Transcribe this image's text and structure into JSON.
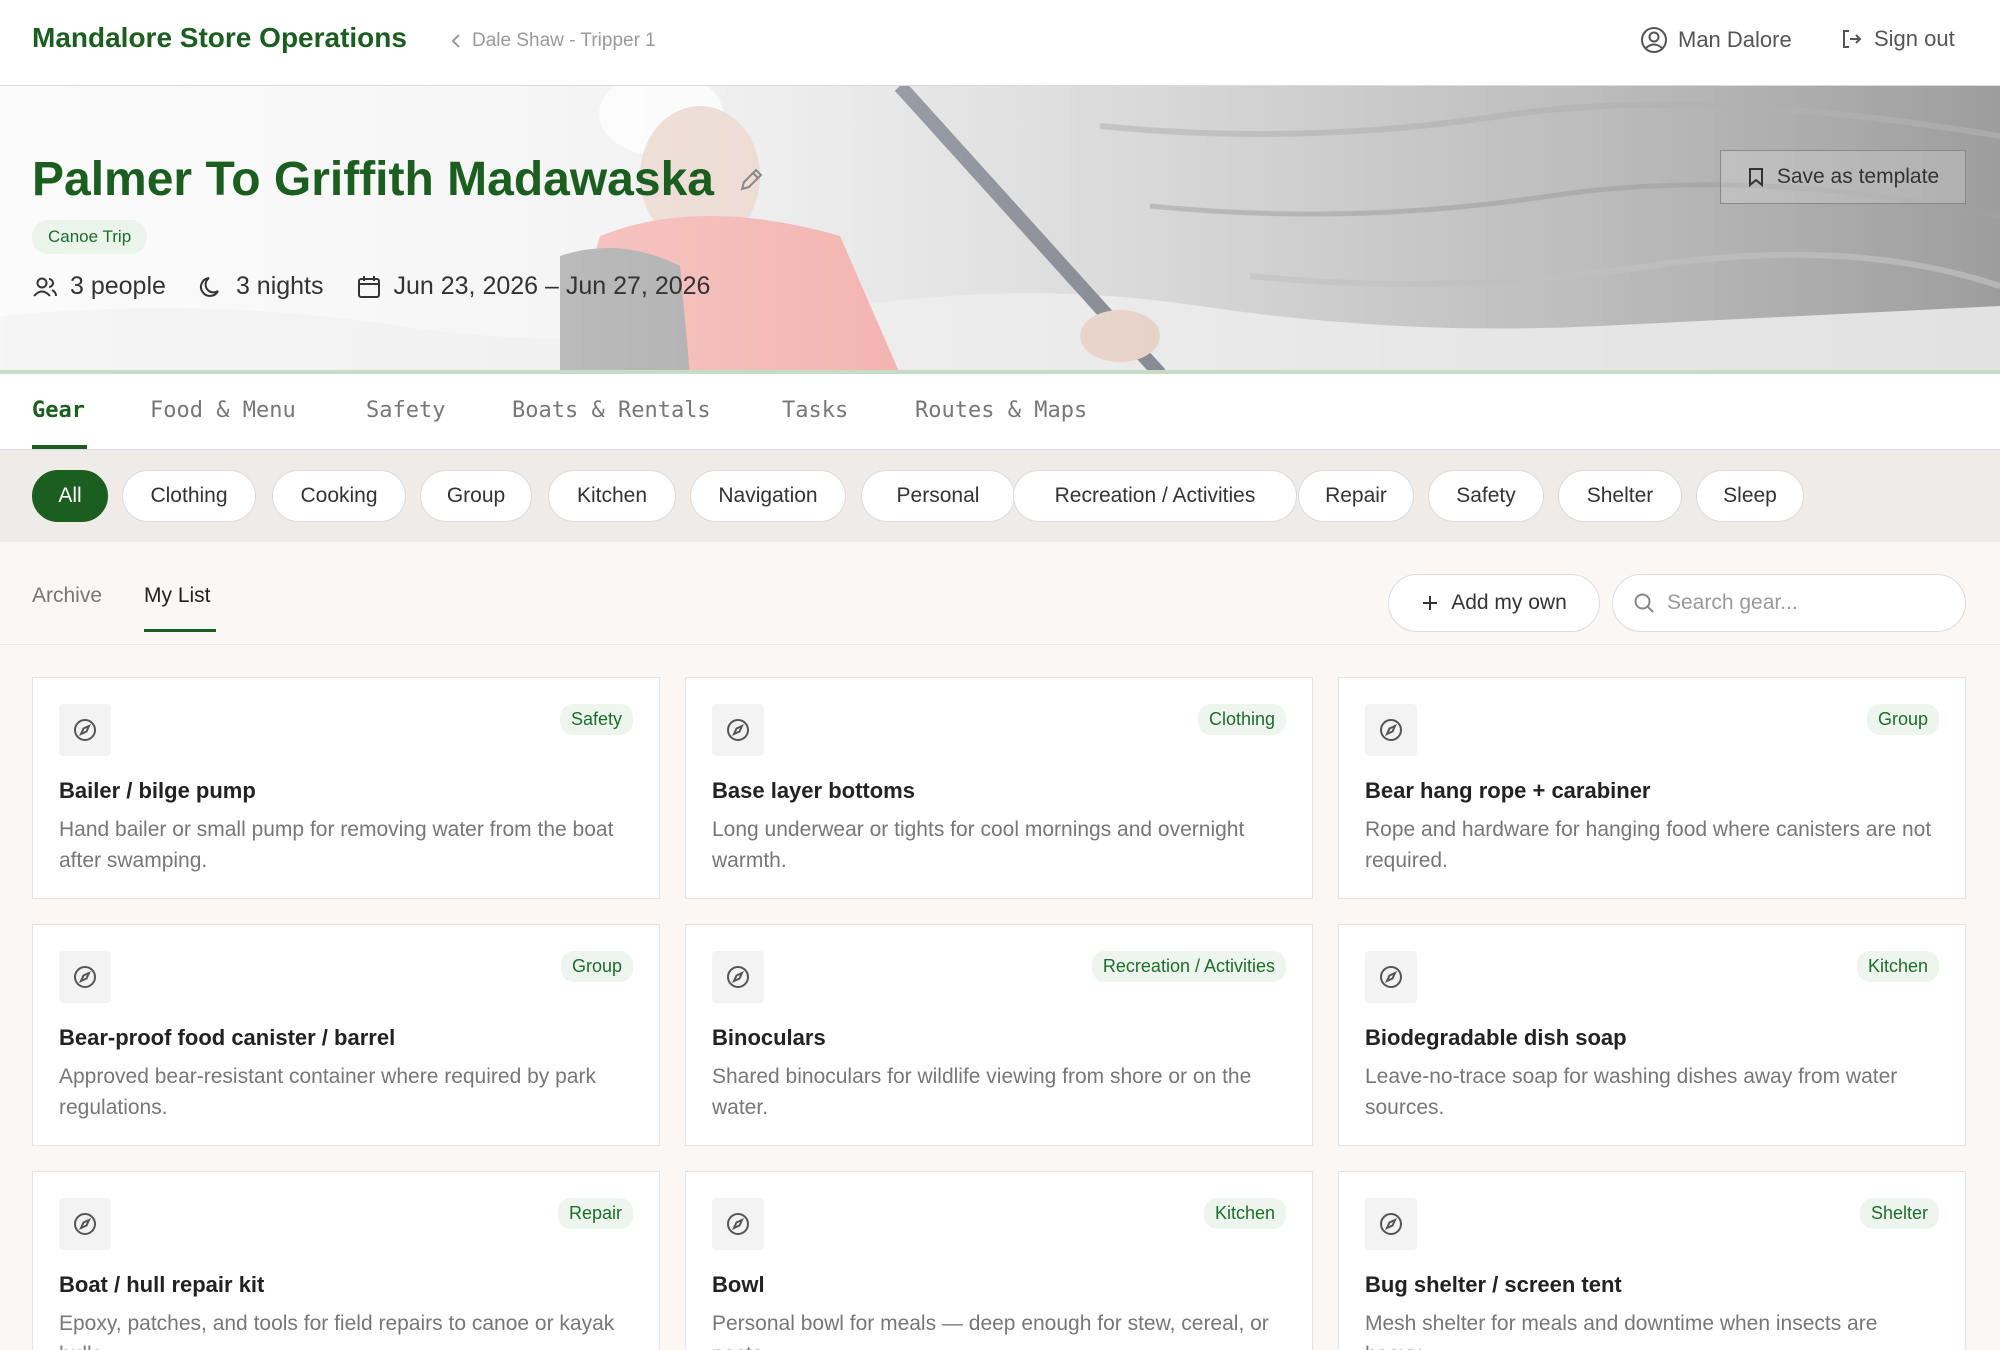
{
  "app": {
    "title": "Mandalore Store Operations"
  },
  "breadcrumb": {
    "label": "Dale Shaw - Tripper 1"
  },
  "user": {
    "name": "Man Dalore",
    "signout_label": "Sign out"
  },
  "trip": {
    "title": "Palmer To Griffith Madawaska",
    "type_badge": "Canoe Trip",
    "people": "3 people",
    "nights": "3 nights",
    "dates": "Jun 23, 2026 – Jun 27, 2026",
    "save_template_label": "Save as template"
  },
  "tabs": [
    {
      "label": "Gear",
      "active": true
    },
    {
      "label": "Food & Menu"
    },
    {
      "label": "Safety"
    },
    {
      "label": "Boats & Rentals"
    },
    {
      "label": "Tasks"
    },
    {
      "label": "Routes & Maps"
    }
  ],
  "categories": [
    {
      "label": "All",
      "active": true
    },
    {
      "label": "Clothing"
    },
    {
      "label": "Cooking"
    },
    {
      "label": "Group"
    },
    {
      "label": "Kitchen"
    },
    {
      "label": "Navigation"
    },
    {
      "label": "Personal"
    },
    {
      "label": "Recreation / Activities"
    },
    {
      "label": "Repair"
    },
    {
      "label": "Safety"
    },
    {
      "label": "Shelter"
    },
    {
      "label": "Sleep"
    }
  ],
  "list_tabs": [
    {
      "label": "Archive"
    },
    {
      "label": "My List",
      "active": true
    }
  ],
  "actions": {
    "add_own_label": "Add my own",
    "search_placeholder": "Search gear..."
  },
  "items": [
    {
      "title": "Bailer / bilge pump",
      "tag": "Safety",
      "description": "Hand bailer or small pump for removing water from the boat after swamping."
    },
    {
      "title": "Base layer bottoms",
      "tag": "Clothing",
      "description": "Long underwear or tights for cool mornings and overnight warmth."
    },
    {
      "title": "Bear hang rope + carabiner",
      "tag": "Group",
      "description": "Rope and hardware for hanging food where canisters are not required."
    },
    {
      "title": "Bear-proof food canister / barrel",
      "tag": "Group",
      "description": "Approved bear-resistant container where required by park regulations."
    },
    {
      "title": "Binoculars",
      "tag": "Recreation / Activities",
      "description": "Shared binoculars for wildlife viewing from shore or on the water."
    },
    {
      "title": "Biodegradable dish soap",
      "tag": "Kitchen",
      "description": "Leave-no-trace soap for washing dishes away from water sources."
    },
    {
      "title": "Boat / hull repair kit",
      "tag": "Repair",
      "description": "Epoxy, patches, and tools for field repairs to canoe or kayak hulls."
    },
    {
      "title": "Bowl",
      "tag": "Kitchen",
      "description": "Personal bowl for meals — deep enough for stew, cereal, or pasta."
    },
    {
      "title": "Bug shelter / screen tent",
      "tag": "Shelter",
      "description": "Mesh shelter for meals and downtime when insects are heavy."
    }
  ],
  "colors": {
    "brand": "#1b5e20",
    "tag_bg": "#eef5ee",
    "tag_text": "#1b6e2a"
  },
  "icons": {
    "item_icon": "compass-icon"
  }
}
